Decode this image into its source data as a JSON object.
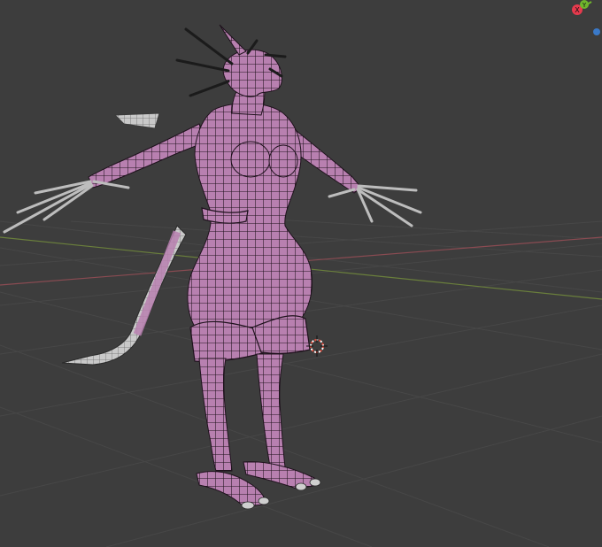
{
  "app": {
    "editor": "3D Viewport"
  },
  "colors": {
    "background": "#3d3d3d",
    "grid": "#4a4a4a",
    "x_axis": "#8a4b52",
    "y_axis": "#6a7f3c",
    "mesh_fill": "#b880b0",
    "mesh_wire": "#1f121d",
    "bone_white": "#c9c9c9",
    "horn_dark": "#1b1b1b",
    "gizmo_x": "#e63a4d",
    "gizmo_y": "#6fb52c",
    "gizmo_z": "#3a79c8",
    "cursor_red": "#e24a3a"
  },
  "icons": {
    "nav_gizmo": "axis-gizmo-icon",
    "cursor": "3d-cursor-icon"
  },
  "gizmo": {
    "x_label": "X",
    "y_label": "Y"
  }
}
